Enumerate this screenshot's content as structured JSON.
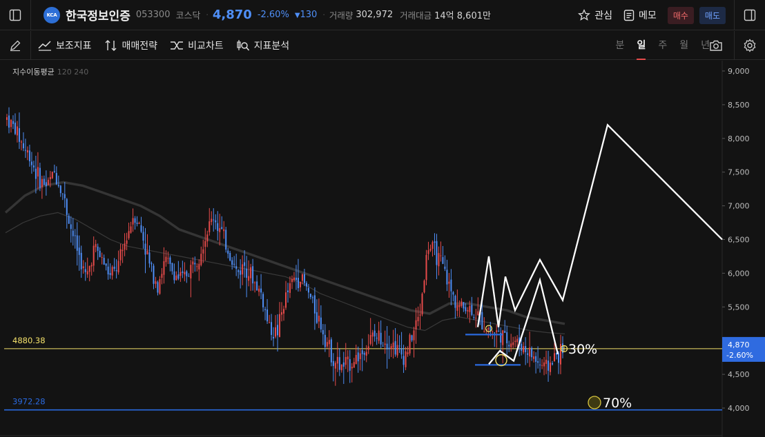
{
  "header": {
    "logo_text": "KCA",
    "stock_name": "한국정보인증",
    "stock_code": "053300",
    "market": "코스닥",
    "price": "4,870",
    "change_pct": "-2.60%",
    "change_amt": "130",
    "volume_label": "거래량",
    "volume": "302,972",
    "turnover_label": "거래대금",
    "turnover": "14억 8,601만",
    "watch_label": "관심",
    "memo_label": "메모",
    "buy_label": "매수",
    "sell_label": "매도"
  },
  "toolbar": {
    "tools": [
      "보조지표",
      "매매전략",
      "비교차트",
      "지표분석"
    ],
    "periods": [
      "분",
      "일",
      "주",
      "월",
      "년"
    ],
    "active_period": "일"
  },
  "legend": {
    "title": "지수이동평균",
    "params": "120 240"
  },
  "colors": {
    "background": "#131313",
    "up": "#e74b4b",
    "down": "#4f8ff7",
    "level_yellow": "#f5e26b",
    "level_blue": "#2a6ae0",
    "drawing": "#ffffff"
  },
  "chart_data": {
    "type": "candlestick",
    "y_axis": {
      "range": [
        3900,
        9100
      ],
      "ticks": [
        "9,000",
        "8,500",
        "8,000",
        "7,500",
        "7,000",
        "6,500",
        "6,000",
        "5,500",
        "5,000",
        "4,500",
        "4,000"
      ]
    },
    "current_price": {
      "label": "4,870",
      "change": "-2.60%",
      "value": 4870
    },
    "horizontal_levels": [
      {
        "label": "4880.38",
        "value": 4880.38,
        "color": "#f5e26b"
      },
      {
        "label": "3972.28",
        "value": 3972.28,
        "color": "#2a6ae0"
      }
    ],
    "price_path_close": [
      8300,
      8150,
      7900,
      7700,
      7400,
      7300,
      7500,
      7200,
      6700,
      6300,
      5900,
      6400,
      6200,
      5950,
      6100,
      6500,
      6900,
      6600,
      6100,
      5850,
      6200,
      6000,
      5900,
      6050,
      6250,
      6550,
      6850,
      6600,
      6300,
      6000,
      6150,
      5900,
      5700,
      5200,
      5100,
      5600,
      5900,
      5950,
      5700,
      5400,
      5100,
      4750,
      4600,
      4650,
      4750,
      4850,
      5050,
      5050,
      5000,
      4900,
      4750,
      5050,
      5400,
      6400,
      6300,
      6050,
      5700,
      5500,
      5500,
      5400,
      5250,
      5150,
      5100,
      5000,
      5000,
      4900,
      4800,
      4650,
      4600,
      4750,
      4870
    ],
    "moving_averages": [
      {
        "name": "120",
        "values": [
          6600,
          6750,
          6850,
          6900,
          6800,
          6650,
          6500,
          6400,
          6350,
          6300,
          6250,
          6200,
          6150,
          6100,
          6050,
          6000,
          5950,
          5850,
          5700,
          5600,
          5500,
          5400,
          5300,
          5200,
          5150,
          5300,
          5350,
          5300,
          5250,
          5200,
          5150,
          5120,
          5100
        ]
      },
      {
        "name": "240",
        "values": [
          6900,
          7150,
          7300,
          7350,
          7300,
          7200,
          7100,
          7000,
          6850,
          6650,
          6550,
          6450,
          6350,
          6250,
          6150,
          6050,
          5950,
          5850,
          5750,
          5650,
          5550,
          5450,
          5400,
          5550,
          5550,
          5500,
          5450,
          5350,
          5300,
          5250
        ]
      }
    ],
    "annotations": [
      {
        "text": "30%",
        "value": 4880.38
      },
      {
        "text": "70%",
        "value": 4000
      }
    ],
    "projection_path": [
      5200,
      6250,
      5200,
      5950,
      5450,
      6200,
      5600,
      8200,
      6500
    ],
    "projection_path_alt": [
      4650,
      4850,
      4700,
      5900,
      4800
    ]
  }
}
